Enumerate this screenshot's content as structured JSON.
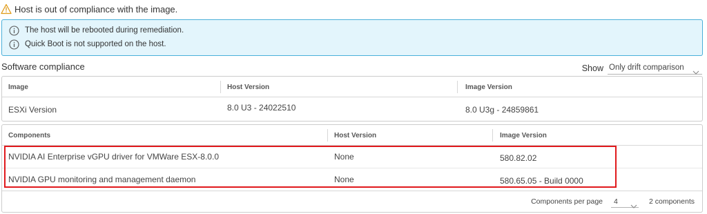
{
  "warning": {
    "text": "Host is out of compliance with the image.",
    "icon": "warning-triangle-icon",
    "color": "#e09a15"
  },
  "info": {
    "lines": [
      "The host will be rebooted during remediation.",
      "Quick Boot is not supported on the host."
    ],
    "icon": "info-circle-icon",
    "background": "#e3f5fc",
    "border": "#49afd9"
  },
  "software_compliance": {
    "title": "Software compliance",
    "show_label": "Show",
    "show_value": "Only drift comparison"
  },
  "image_grid": {
    "headers": [
      "Image",
      "Host Version",
      "Image Version"
    ],
    "rows": [
      [
        "ESXi Version",
        "8.0 U3 - 24022510",
        "8.0 U3g - 24859861"
      ]
    ]
  },
  "components_grid": {
    "headers": [
      "Components",
      "Host Version",
      "Image Version"
    ],
    "rows": [
      [
        "NVIDIA AI Enterprise vGPU driver for VMWare ESX-8.0.0",
        "None",
        "580.82.02"
      ],
      [
        "NVIDIA GPU monitoring and management daemon",
        "None",
        "580.65.05 - Build 0000"
      ]
    ],
    "footer": {
      "per_page_label": "Components per page",
      "per_page_value": "4",
      "count": "2 components"
    }
  },
  "highlight_color": "#e0181b"
}
